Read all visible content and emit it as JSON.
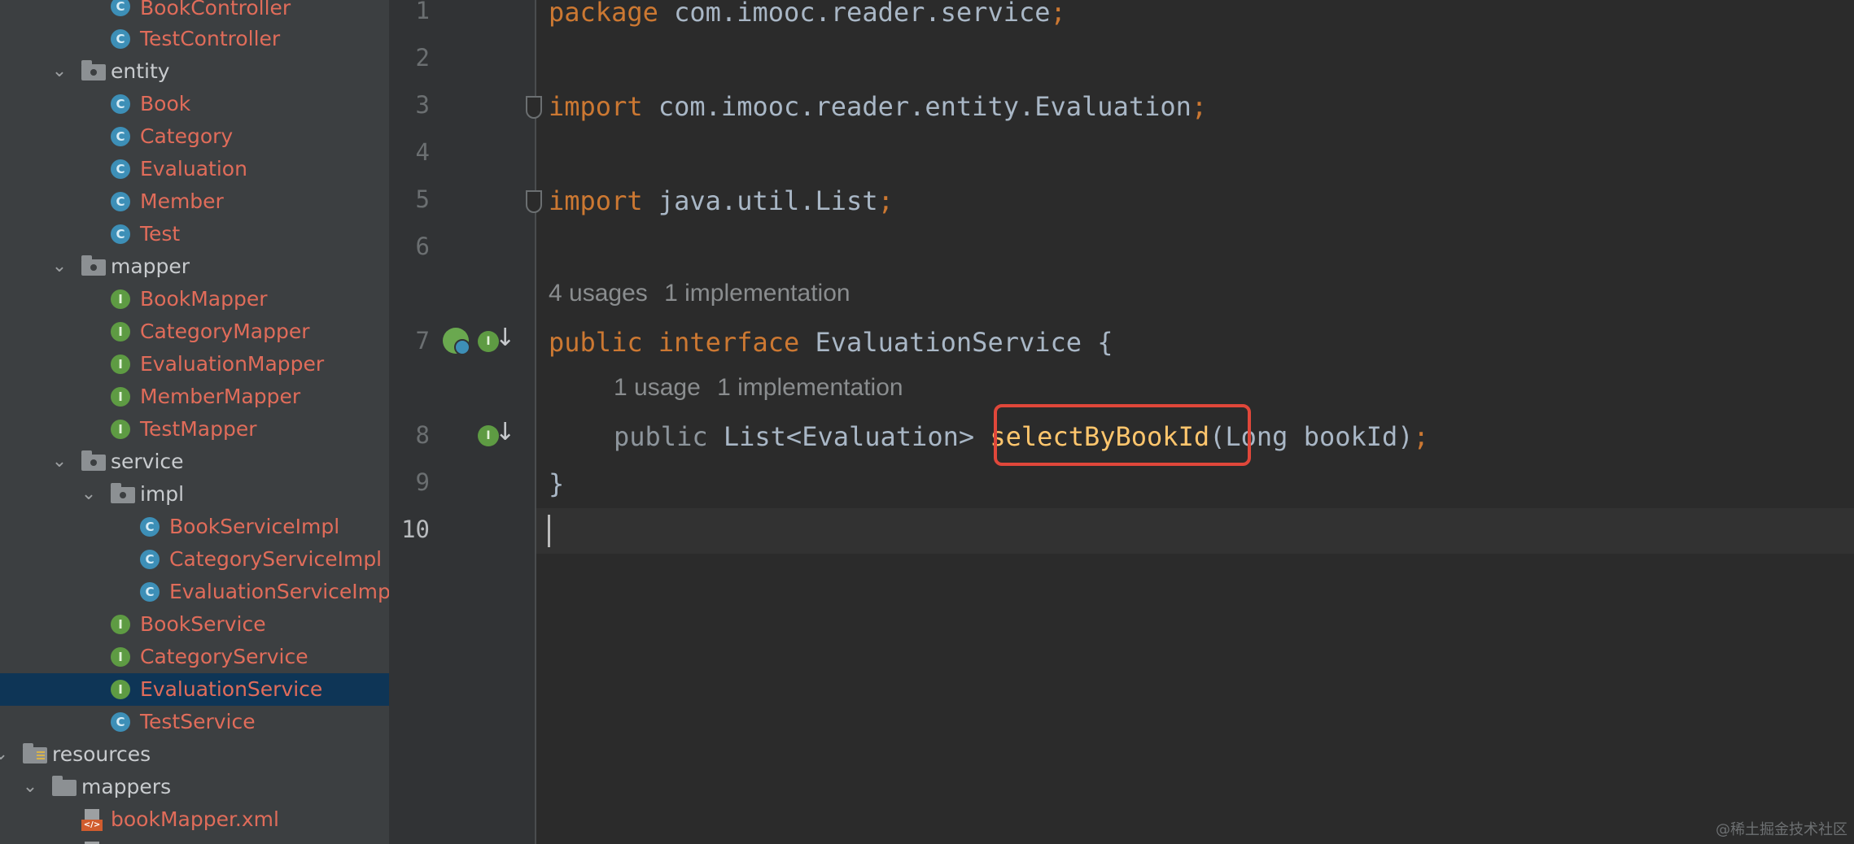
{
  "tree": {
    "items": [
      {
        "label": "BookController",
        "kind": "class"
      },
      {
        "label": "TestController",
        "kind": "class"
      },
      {
        "label": "entity",
        "kind": "package"
      },
      {
        "label": "Book",
        "kind": "class"
      },
      {
        "label": "Category",
        "kind": "class"
      },
      {
        "label": "Evaluation",
        "kind": "class"
      },
      {
        "label": "Member",
        "kind": "class"
      },
      {
        "label": "Test",
        "kind": "class"
      },
      {
        "label": "mapper",
        "kind": "package"
      },
      {
        "label": "BookMapper",
        "kind": "interface"
      },
      {
        "label": "CategoryMapper",
        "kind": "interface"
      },
      {
        "label": "EvaluationMapper",
        "kind": "interface"
      },
      {
        "label": "MemberMapper",
        "kind": "interface"
      },
      {
        "label": "TestMapper",
        "kind": "interface"
      },
      {
        "label": "service",
        "kind": "package"
      },
      {
        "label": "impl",
        "kind": "package"
      },
      {
        "label": "BookServiceImpl",
        "kind": "class"
      },
      {
        "label": "CategoryServiceImpl",
        "kind": "class"
      },
      {
        "label": "EvaluationServiceImpl",
        "kind": "class"
      },
      {
        "label": "BookService",
        "kind": "interface"
      },
      {
        "label": "CategoryService",
        "kind": "interface"
      },
      {
        "label": "EvaluationService",
        "kind": "interface",
        "selected": true
      },
      {
        "label": "TestService",
        "kind": "class"
      },
      {
        "label": "resources",
        "kind": "resources-folder"
      },
      {
        "label": "mappers",
        "kind": "folder"
      },
      {
        "label": "bookMapper.xml",
        "kind": "xml-file"
      }
    ]
  },
  "editor": {
    "line_numbers": [
      "1",
      "2",
      "3",
      "4",
      "5",
      "6",
      "7",
      "8",
      "9",
      "10"
    ],
    "line1": {
      "kw": "package",
      "text": " com.imooc.reader.service",
      "semi": ";"
    },
    "line3": {
      "kw": "import",
      "text": " com.imooc.reader.entity.Evaluation",
      "semi": ";"
    },
    "line5": {
      "kw": "import",
      "text": " java.util.List",
      "semi": ";"
    },
    "hint1": {
      "usages": "4 usages",
      "impl": "1 implementation"
    },
    "line7": {
      "kw1": "public",
      "kw2": "interface",
      "text": " EvaluationService {"
    },
    "hint2": {
      "usages": "1 usage",
      "impl": "1 implementation"
    },
    "line8": {
      "kw": "public",
      "type": " List<Evaluation> ",
      "method": "selectByBookId",
      "params": "(Long bookId)",
      "semi": ";"
    },
    "line9": {
      "text": "}"
    },
    "gutter_icon_letter": "I"
  },
  "watermark": "@稀土掘金技术社区",
  "colors": {
    "keyword": "#cc7832",
    "method": "#ffc66d",
    "error_label": "#e06c5a",
    "highlight_box": "#e0473a",
    "selection": "#0e3556"
  }
}
